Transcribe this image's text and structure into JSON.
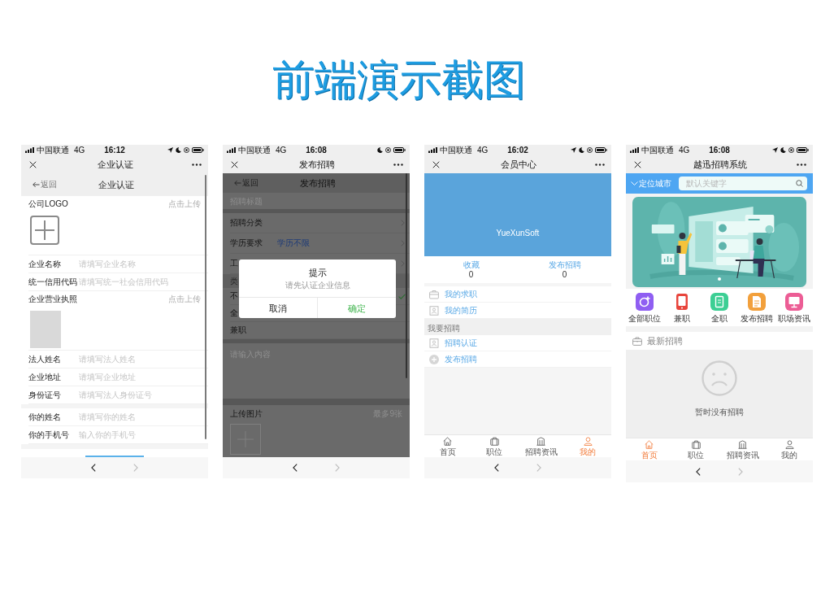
{
  "title": "前端演示截图",
  "screens": [
    {
      "kind": "verify_form",
      "status_bar": {
        "carrier": "中国联通",
        "network": "4G",
        "time": "16:12",
        "location": true
      },
      "nav_title": "企业认证",
      "back_label": "返回",
      "page_title": "企业认证",
      "groups": [
        [
          {
            "kind": "upload",
            "label": "公司LOGO",
            "action": "点击上传",
            "uploaded": false
          },
          {
            "kind": "field",
            "label": "企业名称",
            "placeholder": "请填写企业名称"
          },
          {
            "kind": "field",
            "label": "统一信用代码",
            "placeholder": "请填写统一社会信用代码"
          },
          {
            "kind": "upload",
            "label": "企业营业执照",
            "action": "点击上传",
            "uploaded": true
          },
          {
            "kind": "field",
            "label": "法人姓名",
            "placeholder": "请填写法人姓名"
          },
          {
            "kind": "field",
            "label": "企业地址",
            "placeholder": "请填写企业地址"
          },
          {
            "kind": "field",
            "label": "身份证号",
            "placeholder": "请填写法人身份证号"
          }
        ],
        [
          {
            "kind": "field",
            "label": "你的姓名",
            "placeholder": "请填写你的姓名"
          },
          {
            "kind": "field",
            "label": "你的手机号",
            "placeholder": "输入你的手机号"
          }
        ]
      ]
    },
    {
      "kind": "post_form",
      "status_bar": {
        "carrier": "中国联通",
        "network": "4G",
        "time": "16:08",
        "location": false
      },
      "nav_title": "发布招聘",
      "back_label": "返回",
      "page_title": "发布招聘",
      "dimmed": true,
      "title_placeholder": "招聘标题",
      "selects": [
        {
          "label": "招聘分类"
        },
        {
          "label": "学历要求",
          "value": "学历不限"
        },
        {
          "label": "工"
        }
      ],
      "option_header": "类",
      "options": [
        {
          "label": "不",
          "selected": true
        },
        {
          "label": "全",
          "selected": false
        },
        {
          "label": "兼职",
          "selected": false
        }
      ],
      "content_placeholder": "请输入内容",
      "upload": {
        "label": "上传图片",
        "hint": "最多9张"
      },
      "dialog": {
        "title": "提示",
        "message": "请先认证企业信息",
        "buttons": [
          {
            "label": "取消",
            "kind": "cancel"
          },
          {
            "label": "确定",
            "kind": "confirm"
          }
        ]
      }
    },
    {
      "kind": "member_center",
      "status_bar": {
        "carrier": "中国联通",
        "network": "4G",
        "time": "16:02",
        "location": true
      },
      "nav_title": "会员中心",
      "banner_text": "YueXunSoft",
      "stats": [
        {
          "label": "收藏",
          "value": "0"
        },
        {
          "label": "发布招聘",
          "value": "0"
        }
      ],
      "menu_sections": [
        {
          "items": [
            {
              "label": "我的求职"
            },
            {
              "label": "我的简历"
            }
          ]
        },
        {
          "title": "我要招聘",
          "items": [
            {
              "label": "招聘认证"
            },
            {
              "label": "发布招聘"
            }
          ]
        }
      ],
      "tabs": [
        {
          "label": "首页",
          "selected": false
        },
        {
          "label": "职位",
          "selected": false
        },
        {
          "label": "招聘资讯",
          "selected": false
        },
        {
          "label": "我的",
          "selected": true
        }
      ]
    },
    {
      "kind": "home",
      "status_bar": {
        "carrier": "中国联通",
        "network": "4G",
        "time": "16:08",
        "location": true
      },
      "nav_title": "越迅招聘系统",
      "city_label": "定位城市",
      "search_placeholder": "默认关键字",
      "categories": [
        {
          "label": "全部职位",
          "color": "#8f5ef2"
        },
        {
          "label": "兼职",
          "color": "#e8453c"
        },
        {
          "label": "全职",
          "color": "#3ccf94"
        },
        {
          "label": "发布招聘",
          "color": "#f2a03c"
        },
        {
          "label": "职场资讯",
          "color": "#ec5d95"
        }
      ],
      "section_title": "最新招聘",
      "empty_text": "暂时没有招聘",
      "tabs": [
        {
          "label": "首页",
          "selected": true
        },
        {
          "label": "职位",
          "selected": false
        },
        {
          "label": "招聘资讯",
          "selected": false
        },
        {
          "label": "我的",
          "selected": false
        }
      ]
    }
  ]
}
